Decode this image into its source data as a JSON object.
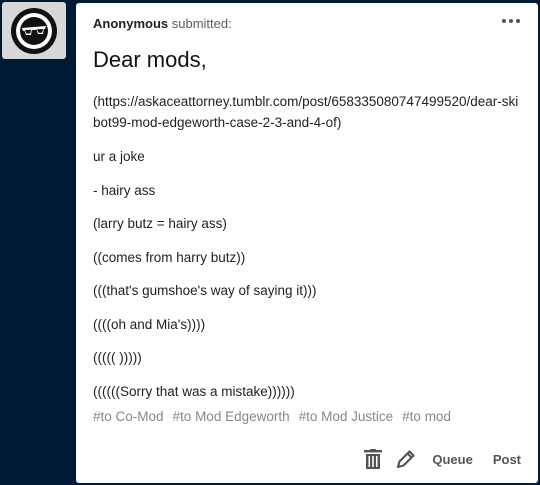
{
  "submission": {
    "author": "Anonymous",
    "action": "submitted:",
    "title": "Dear mods,",
    "body": [
      "(https://askaceattorney.tumblr.com/post/658335080747499520/dear-skibot99-mod-edgeworth-case-2-3-and-4-of)",
      "ur a joke",
      "- hairy ass",
      "(larry butz = hairy ass)",
      "((comes from harry butz))",
      "(((that's gumshoe's way of saying it)))",
      "((((oh and Mia's))))",
      "((((( )))))",
      "((((((Sorry that was a mistake))))))"
    ],
    "tags": [
      "#to Co-Mod",
      "#to Mod Edgeworth",
      "#to Mod Justice",
      "#to mod"
    ]
  },
  "toolbar": {
    "queue_label": "Queue",
    "post_label": "Post"
  },
  "icons": {
    "avatar": "sunglasses-face-icon",
    "more": "more-dots-icon",
    "delete": "trash-icon",
    "edit": "pencil-icon"
  }
}
